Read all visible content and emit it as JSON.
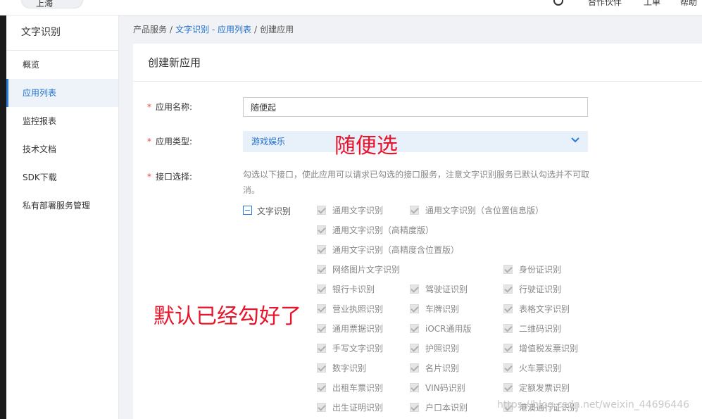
{
  "topbar": {
    "region": "上海",
    "links": [
      "合作伙伴",
      "工单",
      "帮助"
    ]
  },
  "sidebar": {
    "title": "文字识别",
    "items": [
      {
        "label": "概览",
        "active": false
      },
      {
        "label": "应用列表",
        "active": true
      },
      {
        "label": "监控报表",
        "active": false
      },
      {
        "label": "技术文档",
        "active": false
      },
      {
        "label": "SDK下载",
        "active": false
      },
      {
        "label": "私有部署服务管理",
        "active": false
      }
    ]
  },
  "breadcrumb": {
    "root": "产品服务",
    "parent": "文字识别 - 应用列表",
    "current": "创建应用",
    "separator": "/"
  },
  "card": {
    "title": "创建新应用"
  },
  "form": {
    "required_mark": "*",
    "name_label": "应用名称:",
    "name_value": "随便起",
    "type_label": "应用类型:",
    "type_value": "游戏娱乐",
    "api_label": "接口选择:",
    "api_description": "勾选以下接口，使此应用可以请求已勾选的接口服务，注意文字识别服务已默认勾选并不可取消。",
    "group_label": "文字识别",
    "apis": [
      "通用文字识别",
      "通用文字识别（含位置信息版）",
      "通用文字识别（高精度版）",
      "通用文字识别（高精度含位置版）",
      "网络图片文字识别",
      "身份证识别",
      "银行卡识别",
      "驾驶证识别",
      "行驶证识别",
      "营业执照识别",
      "车牌识别",
      "表格文字识别",
      "通用票据识别",
      "iOCR通用版",
      "二维码识别",
      "手写文字识别",
      "护照识别",
      "增值税发票识别",
      "数字识别",
      "名片识别",
      "火车票识别",
      "出租车票识别",
      "VIN码识别",
      "定额发票识别",
      "出生证明识别",
      "户口本识别",
      "港澳通行证识别"
    ]
  },
  "annotations": {
    "type_note": "随便选",
    "default_note": "默认已经勾好了"
  },
  "watermark": "https://blog.csdn.net/weixin_44696446",
  "colors": {
    "accent": "#2a7ad9",
    "link": "#1f6fcc",
    "required": "#e94b35",
    "annotation": "#e8142a"
  }
}
